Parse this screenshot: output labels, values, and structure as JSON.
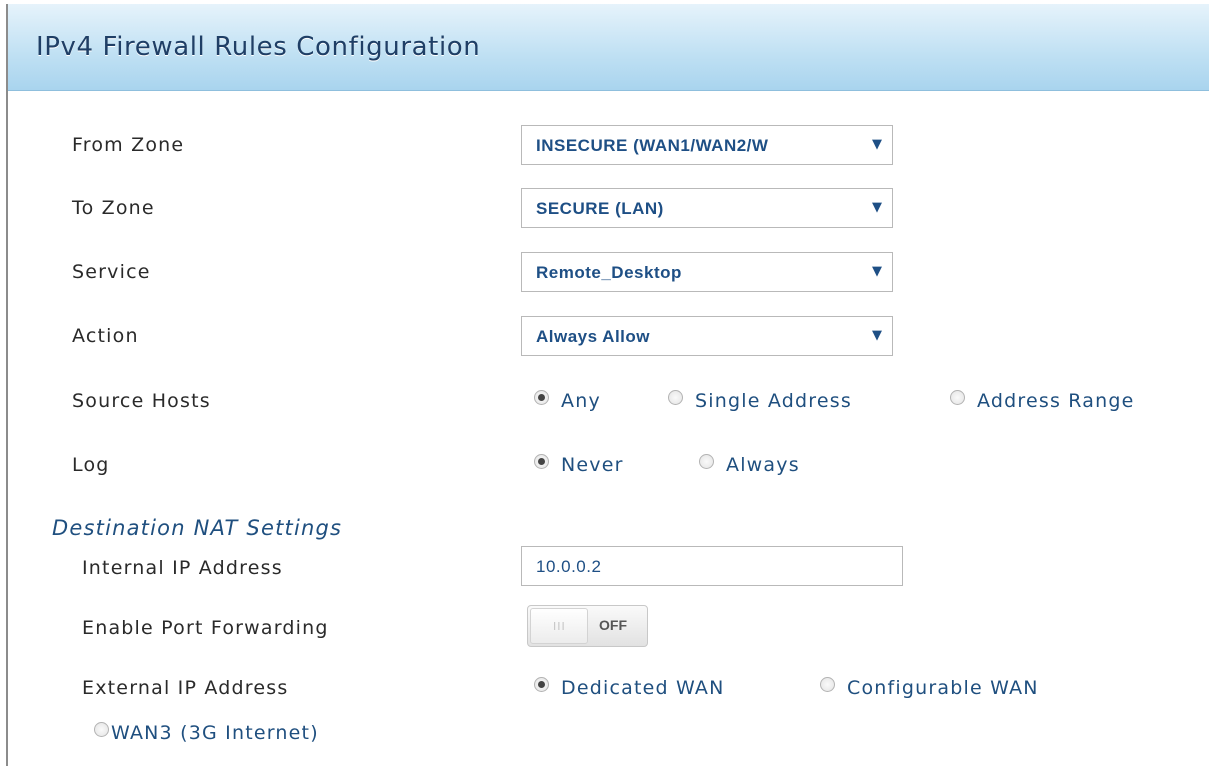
{
  "panel": {
    "title": "IPv4 Firewall Rules Configuration"
  },
  "fields": {
    "from_zone": {
      "label": "From Zone",
      "value": "INSECURE (WAN1/WAN2/W"
    },
    "to_zone": {
      "label": "To Zone",
      "value": "SECURE (LAN)"
    },
    "service": {
      "label": "Service",
      "value": "Remote_Desktop"
    },
    "action": {
      "label": "Action",
      "value": "Always Allow"
    },
    "source_hosts": {
      "label": "Source Hosts",
      "options": [
        "Any",
        "Single Address",
        "Address Range"
      ],
      "selected": "Any"
    },
    "log": {
      "label": "Log",
      "options": [
        "Never",
        "Always"
      ],
      "selected": "Never"
    }
  },
  "nat": {
    "section_title": "Destination NAT Settings",
    "internal_ip": {
      "label": "Internal IP Address",
      "value": "10.0.0.2"
    },
    "port_forwarding": {
      "label": "Enable Port Forwarding",
      "state": "OFF",
      "grip": "III"
    },
    "external_ip": {
      "label": "External IP Address",
      "options": [
        "Dedicated WAN",
        "Configurable WAN",
        "WAN3 (3G Internet)"
      ],
      "selected": "Dedicated WAN"
    }
  },
  "icons": {
    "dropdown": "triangle-down-icon",
    "radio": "radio-icon"
  },
  "colors": {
    "accent": "#1e4f85",
    "header_bg": "#bfe0f3",
    "title": "#1f3f66"
  },
  "dropdown_arrow": "▼"
}
